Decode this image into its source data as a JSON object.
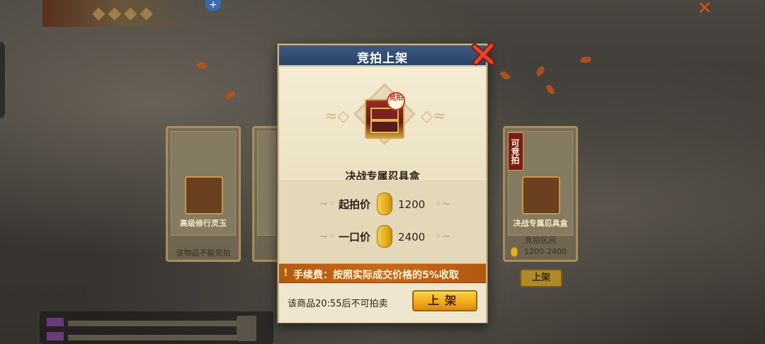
{
  "dialog": {
    "title": "竞拍上架",
    "item_name": "决战专属忍具盒",
    "auction_badge": "竞拍",
    "start_price_label": "起拍价",
    "start_price_value": "1200",
    "buyout_label": "一口价",
    "buyout_value": "2400",
    "fee_text": "手续费：按照实际成交价格的5%收取",
    "fee_icon": "!",
    "notice": "该商品20:55后不可拍卖",
    "list_button": "上架"
  },
  "background": {
    "cards": [
      {
        "item_name": "高级修行灵玉",
        "footer": "该物品不能竞拍"
      },
      {
        "item_name": "决战专属忍具盒",
        "tag": "可竞拍",
        "range_label": "竞拍区间",
        "range_value": "1200-2400"
      }
    ],
    "list_button": "上架"
  },
  "colors": {
    "header_blue": "#2b4466",
    "fee_orange": "#c9681a",
    "button_gold": "#f2a81a",
    "coin_gold": "#e6ae1c"
  },
  "icons": {
    "close": "close-icon",
    "coin": "coin-icon",
    "warning": "warning-icon"
  }
}
